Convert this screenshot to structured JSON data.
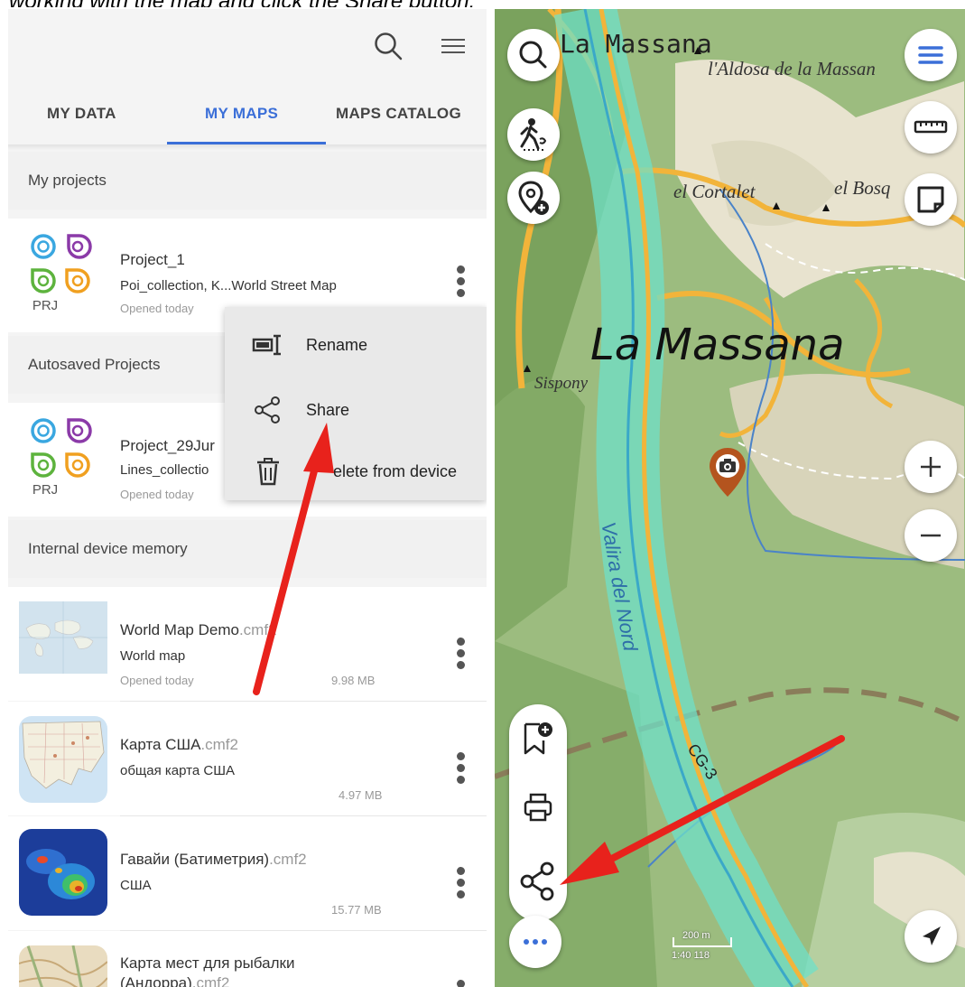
{
  "caption": "working with the map and click the Share button.",
  "left": {
    "tabs": [
      {
        "label": "MY DATA"
      },
      {
        "label": "MY MAPS"
      },
      {
        "label": "MAPS CATALOG"
      }
    ],
    "sections": {
      "my_projects": "My projects",
      "autosaved": "Autosaved Projects",
      "internal": "Internal device memory"
    },
    "projects": [
      {
        "title": "Project_1",
        "subtitle": "Poi_collection, K...World Street Map",
        "meta": "Opened today",
        "badge": "PRJ"
      },
      {
        "title": "Project_29Jur",
        "subtitle": "Lines_collectio",
        "meta": "Opened today",
        "badge": "PRJ"
      }
    ],
    "maps": [
      {
        "name": "World Map Demo",
        "ext": ".cmf2",
        "desc": "World map",
        "meta": "Opened today",
        "size": "9.98 MB"
      },
      {
        "name": "Карта США",
        "ext": ".cmf2",
        "desc": "общая карта США",
        "meta": "",
        "size": "4.97 MB"
      },
      {
        "name": "Гавайи (Батиметрия)",
        "ext": ".cmf2",
        "desc": "США",
        "meta": "",
        "size": "15.77 MB"
      },
      {
        "name": "Карта мест для рыбалки",
        "name2": "(Андорра)",
        "ext": ".cmf2"
      }
    ],
    "menu": [
      {
        "label": "Rename",
        "icon": "rename-icon"
      },
      {
        "label": "Share",
        "icon": "share-icon"
      },
      {
        "label": "Delete from device",
        "visible_label": "elete from device",
        "icon": "trash-icon"
      }
    ]
  },
  "map": {
    "labels": {
      "la_massana_top": "La Massana",
      "aldosa": "l'Aldosa de la Massan",
      "cortalet": "el Cortalet",
      "bosq": "el Bosq",
      "la_massana_big": "La Massana",
      "sispony": "Sispony",
      "river": "Valira del Nord",
      "road": "CG-3"
    },
    "scale_top": "200 m",
    "scale_bottom": "1:40 118"
  },
  "colors": {
    "accent": "#3b6fd8",
    "arrow": "#e8221c",
    "river": "#6fe0c8",
    "road": "#f2b43a",
    "poi": "#b4541e"
  }
}
